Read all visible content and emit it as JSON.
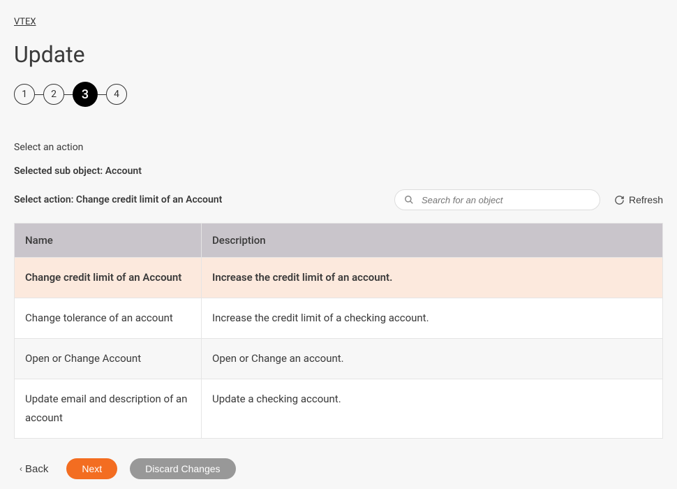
{
  "breadcrumb": "VTEX",
  "page_title": "Update",
  "stepper": {
    "steps": [
      "1",
      "2",
      "3",
      "4"
    ],
    "active_index": 2
  },
  "section_label": "Select an action",
  "subobject_label": "Selected sub object: Account",
  "action_label": "Select action: Change credit limit of an Account",
  "search": {
    "placeholder": "Search for an object"
  },
  "refresh_label": "Refresh",
  "table": {
    "headers": {
      "name": "Name",
      "description": "Description"
    },
    "rows": [
      {
        "name": "Change credit limit of an Account",
        "description": "Increase the credit limit of an account.",
        "selected": true
      },
      {
        "name": "Change tolerance of an account",
        "description": "Increase the credit limit of a checking account.",
        "selected": false
      },
      {
        "name": "Open or Change Account",
        "description": "Open or Change an account.",
        "selected": false
      },
      {
        "name": "Update email and description of an account",
        "description": "Update a checking account.",
        "selected": false
      }
    ]
  },
  "footer": {
    "back": "Back",
    "next": "Next",
    "discard": "Discard Changes"
  }
}
